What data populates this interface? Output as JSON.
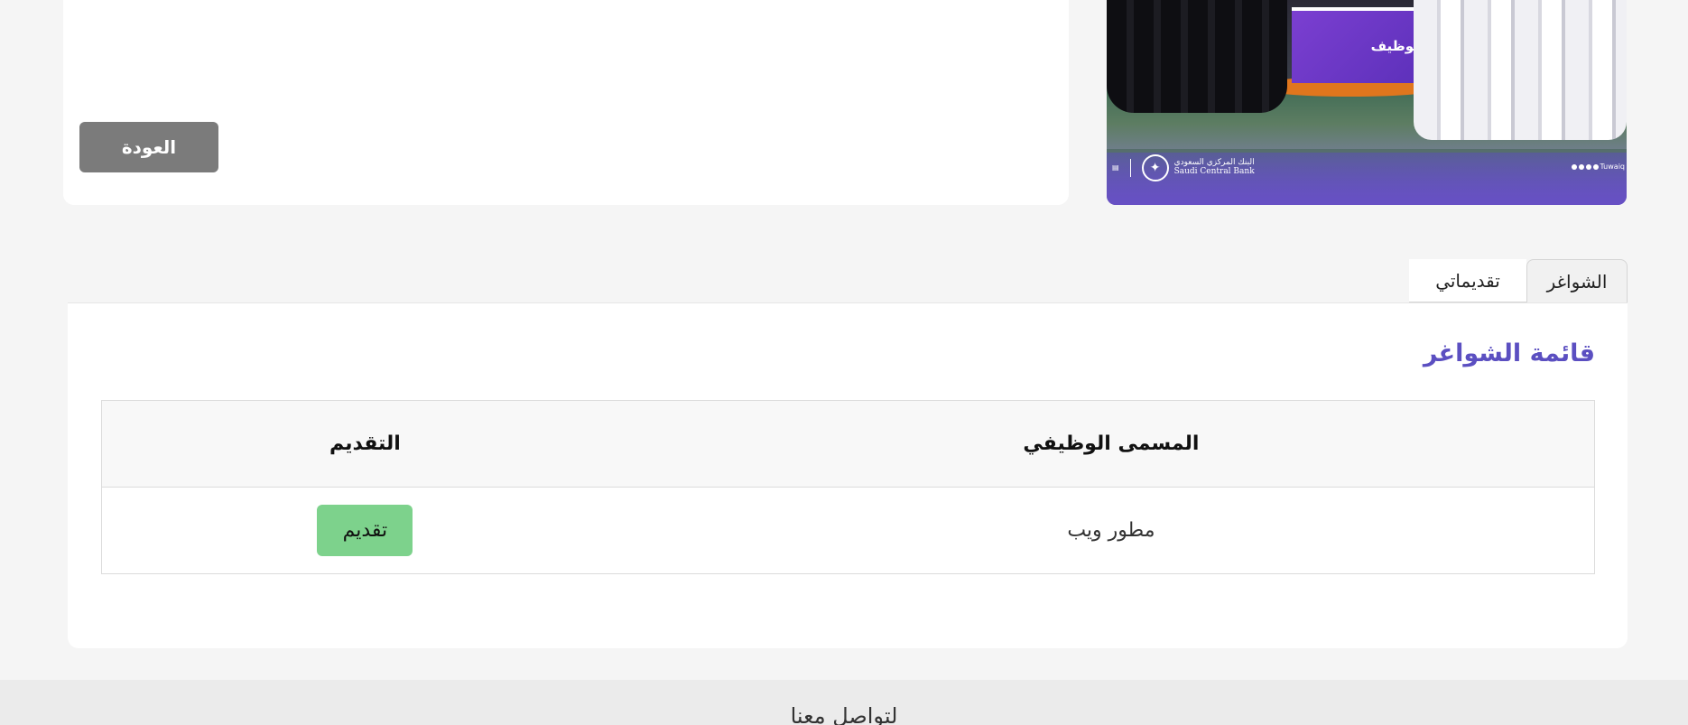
{
  "details": {
    "back_label": "العودة"
  },
  "hero": {
    "booth_text": "للتوظيف",
    "bank_name_en": "Saudi Central Bank",
    "bank_name_ar": "البنك المركزي السعودي",
    "social_handle": "Tuwaiq"
  },
  "tabs": [
    {
      "label": "الشواغر",
      "active": true
    },
    {
      "label": "تقديماتي",
      "active": false
    }
  ],
  "vacancies": {
    "title": "قائمة الشواغر",
    "columns": [
      "المسمى الوظيفي",
      "التقديم"
    ],
    "rows": [
      {
        "job_title": "مطور ويب",
        "apply_label": "تقديم"
      }
    ]
  },
  "footer": {
    "heading": "لتواصل معنا"
  },
  "colors": {
    "accent": "#5b4fc1",
    "apply_button": "#7dd28c",
    "back_button": "#7b7b7b"
  }
}
